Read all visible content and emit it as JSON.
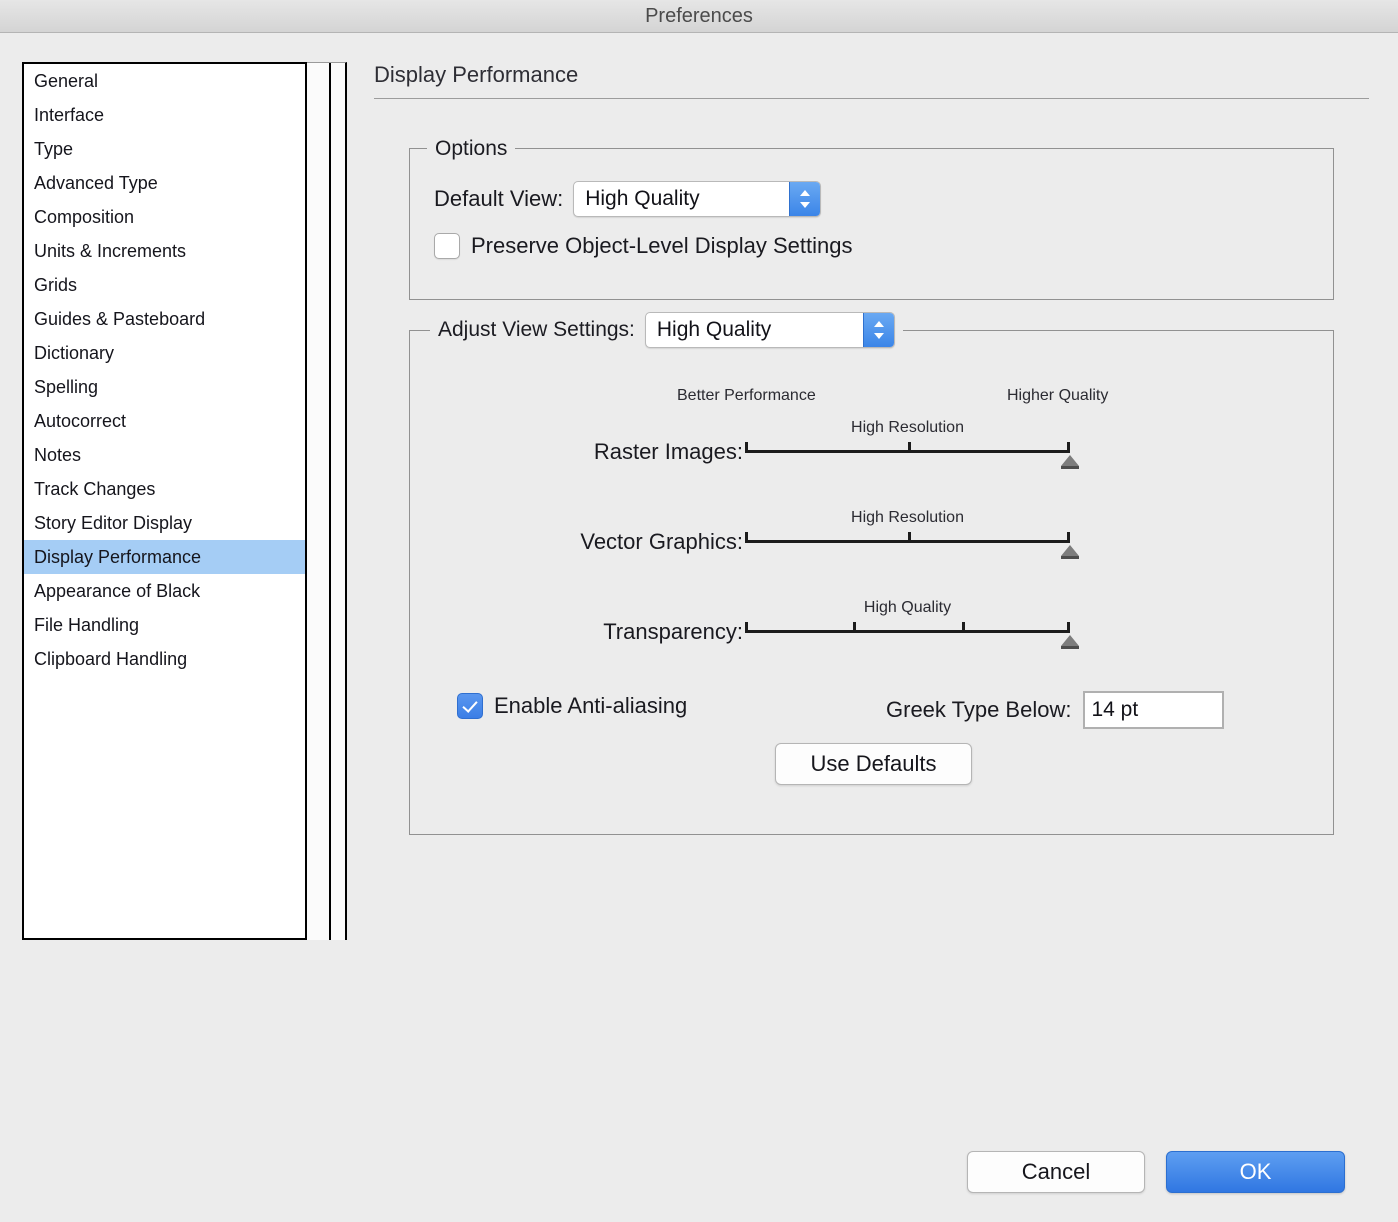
{
  "window": {
    "title": "Preferences"
  },
  "sidebar": {
    "items": [
      {
        "label": "General",
        "selected": false
      },
      {
        "label": "Interface",
        "selected": false
      },
      {
        "label": "Type",
        "selected": false
      },
      {
        "label": "Advanced Type",
        "selected": false
      },
      {
        "label": "Composition",
        "selected": false
      },
      {
        "label": "Units & Increments",
        "selected": false
      },
      {
        "label": "Grids",
        "selected": false
      },
      {
        "label": "Guides & Pasteboard",
        "selected": false
      },
      {
        "label": "Dictionary",
        "selected": false
      },
      {
        "label": "Spelling",
        "selected": false
      },
      {
        "label": "Autocorrect",
        "selected": false
      },
      {
        "label": "Notes",
        "selected": false
      },
      {
        "label": "Track Changes",
        "selected": false
      },
      {
        "label": "Story Editor Display",
        "selected": false
      },
      {
        "label": "Display Performance",
        "selected": true
      },
      {
        "label": "Appearance of Black",
        "selected": false
      },
      {
        "label": "File Handling",
        "selected": false
      },
      {
        "label": "Clipboard Handling",
        "selected": false
      }
    ]
  },
  "panel": {
    "title": "Display Performance",
    "options_group": {
      "legend": "Options",
      "default_view_label": "Default View:",
      "default_view_value": "High Quality",
      "preserve_label": "Preserve Object-Level Display Settings",
      "preserve_checked": false
    },
    "adjust_group": {
      "legend": "Adjust View Settings:",
      "preset_value": "High Quality",
      "scale_left_label": "Better Performance",
      "scale_right_label": "Higher Quality",
      "sliders": [
        {
          "label": "Raster Images:",
          "caption": "High Resolution",
          "ticks": 3,
          "value_index": 2,
          "caption_position_pct": 50
        },
        {
          "label": "Vector Graphics:",
          "caption": "High Resolution",
          "ticks": 3,
          "value_index": 2,
          "caption_position_pct": 50
        },
        {
          "label": "Transparency:",
          "caption": "High Quality",
          "ticks": 4,
          "value_index": 3,
          "caption_position_pct": 50
        }
      ],
      "antialias_label": "Enable Anti-aliasing",
      "antialias_checked": true,
      "greek_label": "Greek Type Below:",
      "greek_value": "14 pt",
      "use_defaults_label": "Use Defaults"
    }
  },
  "footer": {
    "cancel_label": "Cancel",
    "ok_label": "OK"
  },
  "colors": {
    "window_background": "#ececec",
    "selection_blue": "#a5cdf5",
    "accent_blue": "#3b7ee6",
    "ok_button_blue": "#3077e2",
    "list_background": "#ffffff",
    "group_border": "#919191"
  }
}
